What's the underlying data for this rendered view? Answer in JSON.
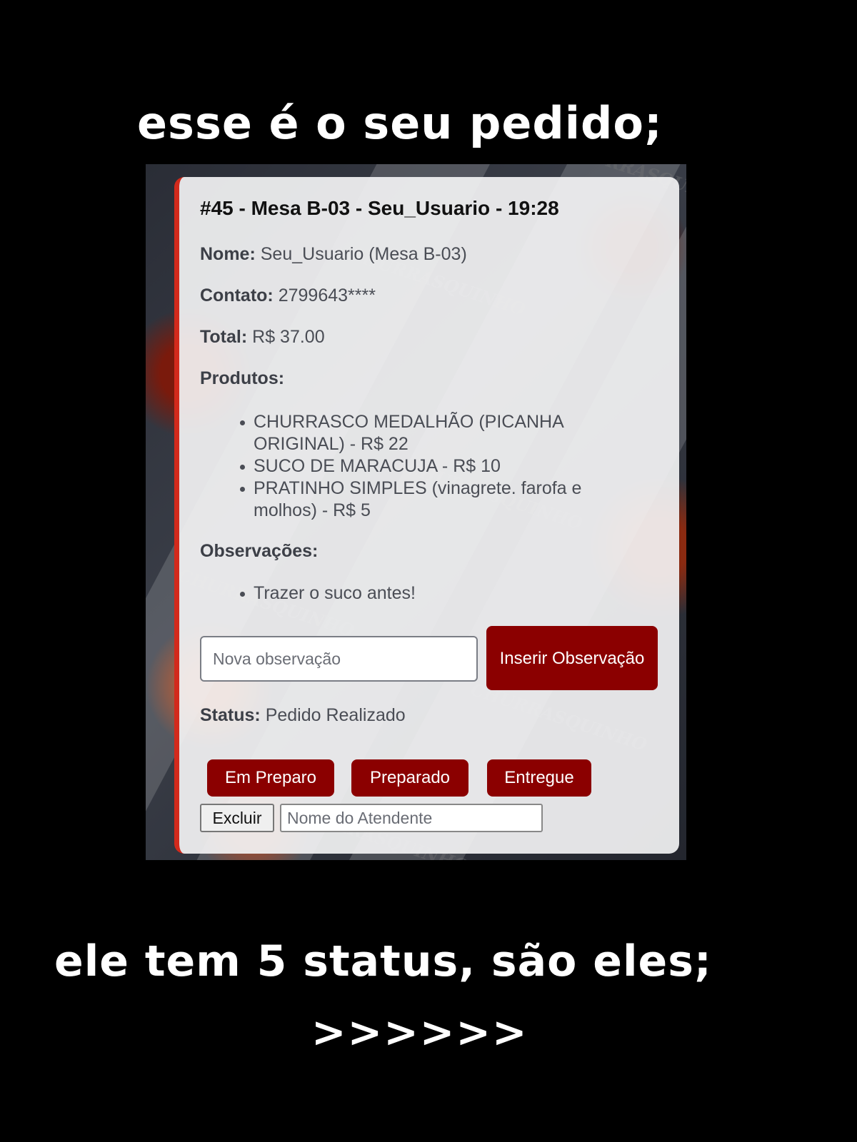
{
  "captions": {
    "top": "esse é o seu pedido;",
    "bottom": "ele tem 5 status, são eles;",
    "arrows": ">>>>>>"
  },
  "background": {
    "logo_text": "CHURRASQUINHO",
    "logo_sub": "Lelê"
  },
  "order": {
    "title": "#45 - Mesa B-03 - Seu_Usuario - 19:28",
    "name_label": "Nome:",
    "name_value": "Seu_Usuario (Mesa B-03)",
    "contact_label": "Contato:",
    "contact_value": "2799643****",
    "total_label": "Total:",
    "total_value": "R$ 37.00",
    "products_label": "Produtos:",
    "products": [
      "CHURRASCO MEDALHÃO (PICANHA ORIGINAL) - R$ 22",
      "SUCO DE MARACUJA - R$ 10",
      "PRATINHO SIMPLES (vinagrete. farofa e molhos) - R$ 5"
    ],
    "observations_label": "Observações:",
    "observations": [
      "Trazer o suco antes!"
    ],
    "new_observation_placeholder": "Nova observação",
    "insert_observation_button": "Inserir Observação",
    "status_label": "Status:",
    "status_value": "Pedido Realizado",
    "status_buttons": {
      "preparing": "Em Preparo",
      "prepared": "Preparado",
      "delivered": "Entregue"
    },
    "delete_button": "Excluir",
    "attendant_placeholder": "Nome do Atendente"
  },
  "colors": {
    "page_background": "#000000",
    "accent_red": "#8b0000",
    "card_border": "#d22a1c",
    "card_background": "#f3f3f4"
  }
}
